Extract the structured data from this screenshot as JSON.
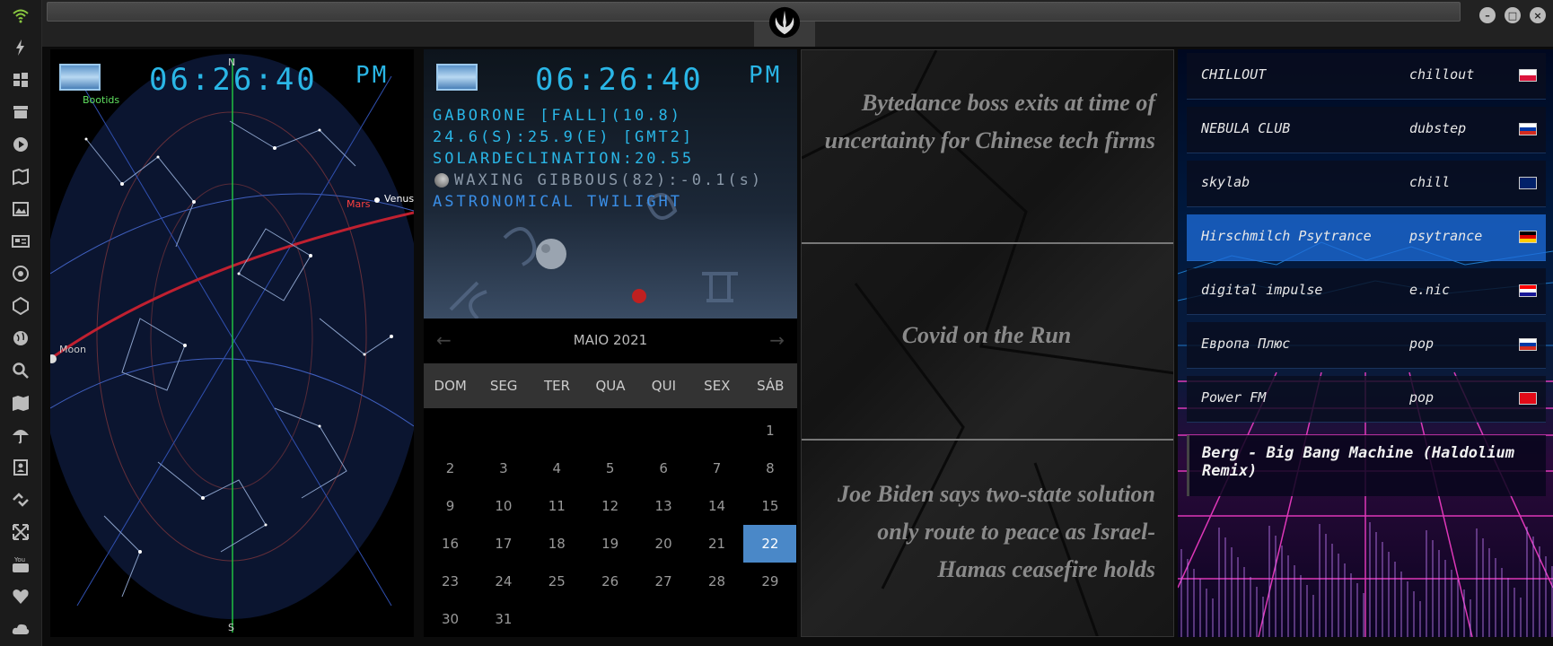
{
  "sidebar": {
    "icons": [
      "wifi-icon",
      "flash-icon",
      "windows-icon",
      "archive-icon",
      "play-icon",
      "map-book-icon",
      "image-icon",
      "news-icon",
      "helm-icon",
      "hexagon-icon",
      "globe-icon",
      "search-icon",
      "map-icon",
      "umbrella-icon",
      "contact-icon",
      "link-icon",
      "expand-icon",
      "youtube-icon",
      "heart-icon",
      "cloud-icon"
    ]
  },
  "starmap": {
    "time": "06:26:40",
    "ampm": "PM",
    "north": "N",
    "south": "S",
    "labels": {
      "bootids": "Bootids",
      "mars": "Mars",
      "venus": "Venus",
      "moon": "Moon"
    }
  },
  "astro": {
    "time": "06:26:40",
    "ampm": "PM",
    "location": "GABORONE [FALL](10.8)",
    "coords": "24.6(S):25.9(E) [GMT2]",
    "declination": "SOLARDECLINATION:20.55",
    "moon_phase": "WAXING GIBBOUS(82):-0.1(s)",
    "twilight": "ASTRONOMICAL TWILIGHT"
  },
  "calendar": {
    "month": "MAIO 2021",
    "prev": "←",
    "next": "→",
    "weekdays": [
      "DOM",
      "SEG",
      "TER",
      "QUA",
      "QUI",
      "SEX",
      "SÁB"
    ],
    "first_weekday": 6,
    "days": 31,
    "selected": 22
  },
  "news": {
    "items": [
      "Bytedance boss exits at time of uncertainty for Chinese tech firms",
      "Covid on the Run",
      "Joe Biden says two-state solution only route to peace as Israel-Hamas ceasefire holds"
    ]
  },
  "radio": {
    "stations": [
      {
        "name": "CHILLOUT",
        "genre": "chillout",
        "flag": "poland",
        "active": false
      },
      {
        "name": "NEBULA CLUB",
        "genre": "dubstep",
        "flag": "russia",
        "active": false
      },
      {
        "name": "skylab",
        "genre": "chill",
        "flag": "uk",
        "active": false
      },
      {
        "name": "Hirschmilch Psytrance",
        "genre": "psytrance",
        "flag": "germany",
        "active": true
      },
      {
        "name": "digital impulse",
        "genre": "e.nic",
        "flag": "croatia",
        "active": false
      },
      {
        "name": "Европа Плюс",
        "genre": "pop",
        "flag": "russia",
        "active": false
      },
      {
        "name": "Power FM",
        "genre": "pop",
        "flag": "turkey",
        "active": false
      }
    ],
    "now_playing": "Berg - Big Bang Machine (Haldolium Remix)"
  },
  "colors": {
    "accent": "#2ab6e6",
    "calendar_selected": "#4a88c8",
    "mars": "#e03030"
  }
}
